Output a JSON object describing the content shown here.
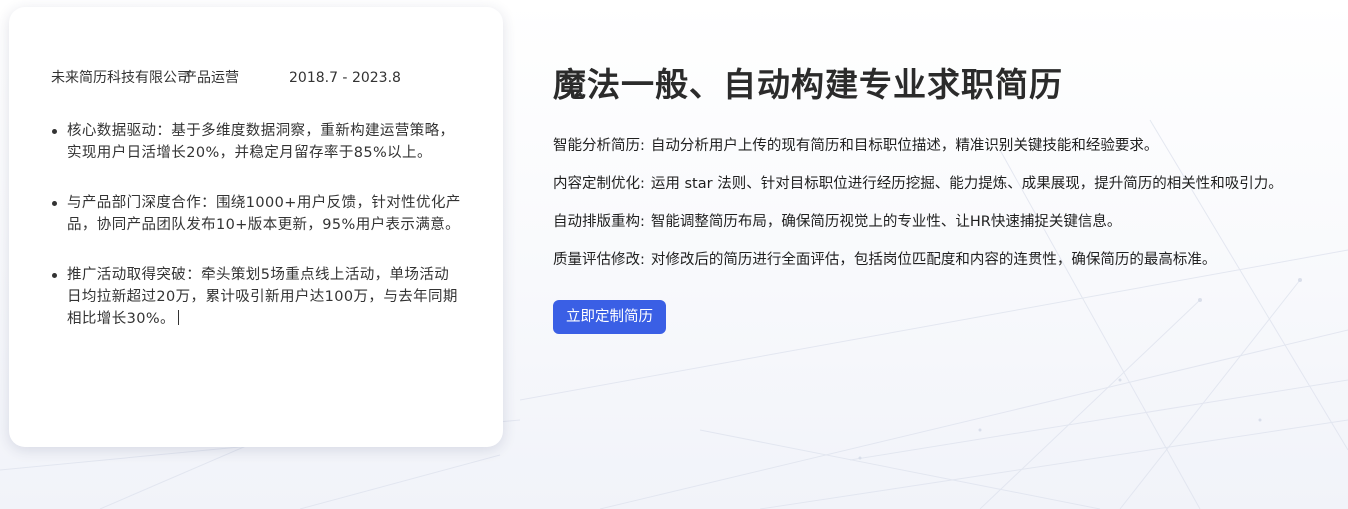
{
  "resume_card": {
    "company": "未来简历科技有限公司",
    "role": "产品运营",
    "period": "2018.7 - 2023.8",
    "bullets": [
      "核心数据驱动：基于多维度数据洞察，重新构建运营策略，实现用户日活增长20%，并稳定月留存率于85%以上。",
      "与产品部门深度合作：围绕1000+用户反馈，针对性优化产品，协同产品团队发布10+版本更新，95%用户表示满意。",
      "推广活动取得突破：牵头策划5场重点线上活动，单场活动日均拉新超过20万，累计吸引新用户达100万，与去年同期相比增长30%。"
    ]
  },
  "feature_section": {
    "headline": "魔法一般、自动构建专业求职简历",
    "features": [
      {
        "label": "智能分析简历:",
        "text": "自动分析用户上传的现有简历和目标职位描述，精准识别关键技能和经验要求。"
      },
      {
        "label": "内容定制优化:",
        "text": "运用 star 法则、针对目标职位进行经历挖掘、能力提炼、成果展现，提升简历的相关性和吸引力。"
      },
      {
        "label": "自动排版重构:",
        "text": "智能调整简历布局，确保简历视觉上的专业性、让HR快速捕捉关键信息。"
      },
      {
        "label": "质量评估修改:",
        "text": "对修改后的简历进行全面评估，包括岗位匹配度和内容的连贯性，确保简历的最高标准。"
      }
    ],
    "cta_label": "立即定制简历"
  },
  "colors": {
    "cta_background": "#3a5fe5",
    "headline_text": "#2b2b2b",
    "card_background": "#ffffff"
  }
}
